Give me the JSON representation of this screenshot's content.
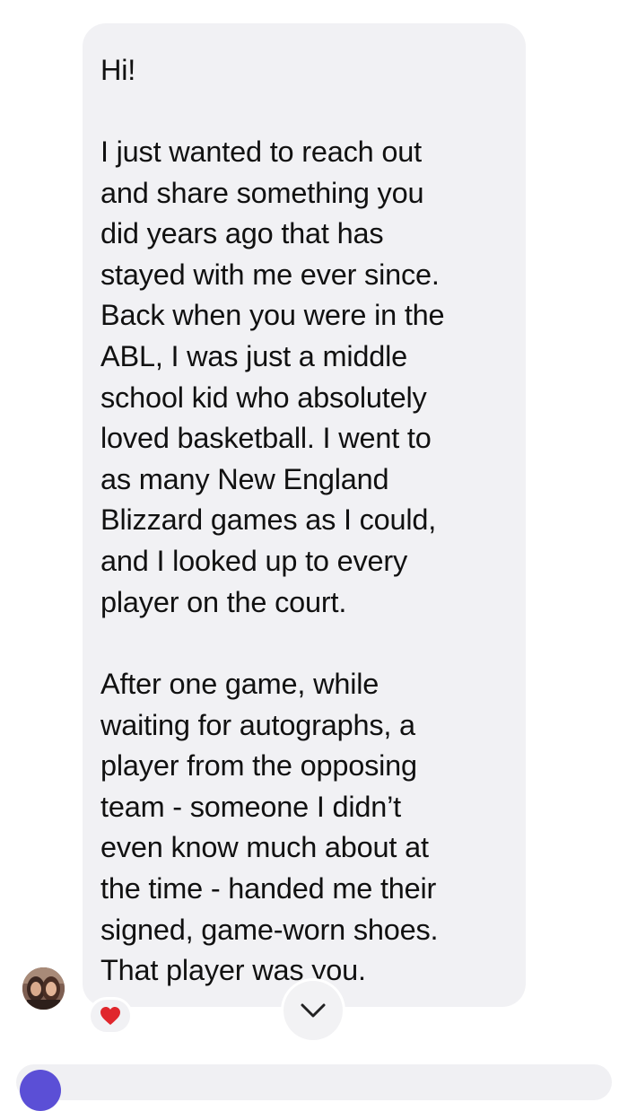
{
  "message": {
    "greeting": "Hi!",
    "paragraph_2": "I just wanted to reach out\nand share something you\ndid years ago that has\nstayed with me ever since.\nBack when you were in the\nABL, I was just a middle\nschool kid who absolutely\nloved basketball. I went to\nas many New England\nBlizzard games as I could,\nand I looked up to every\nplayer on the court.",
    "paragraph_3": "After one game, while\nwaiting for autographs, a\nplayer from the opposing\nteam - someone I didn’t\neven know much about at\nthe time - handed me their\nsigned, game-worn shoes.\nThat player was you."
  },
  "reaction": {
    "icon": "heart-icon",
    "color": "#e0262c"
  },
  "scroll_button": {
    "icon": "chevron-down-icon"
  },
  "colors": {
    "bubble_background": "#f1f1f4",
    "text": "#111111",
    "composer_accent": "#5b4fd6"
  }
}
